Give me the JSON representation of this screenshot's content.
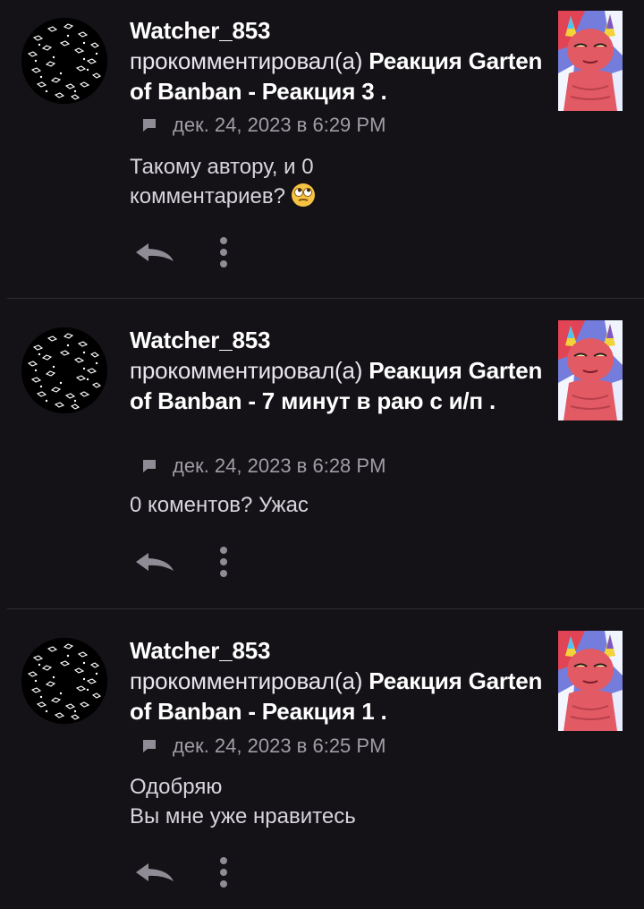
{
  "colors": {
    "background": "#141216",
    "divider": "#2e2c31",
    "primary_text": "#ffffff",
    "secondary_text": "#a09da5",
    "comment_text": "#d7d4dc",
    "icon": "#8f8c95"
  },
  "icons": {
    "comment": "speech-bubble-icon",
    "reply": "reply-arrow-icon",
    "more": "vertical-dots-icon"
  },
  "notifications": [
    {
      "username": "Watcher_853",
      "action": "прокомментировал(а) ",
      "post_title": "Реакция Garten of Banban - Реакция 3",
      "title_end": " .",
      "timestamp": "дек. 24, 2023 в 6:29 PM",
      "comment": "Такому автору, и 0\nкомментариев?",
      "emoji": "face-with-rolling-eyes"
    },
    {
      "username": "Watcher_853",
      "action": "прокомментировал(а) ",
      "post_title": "Реакция Garten of Banban - 7 минут в раю с и/п",
      "title_end": " .",
      "timestamp": "дек. 24, 2023 в 6:28 PM",
      "comment": "0 коментов? Ужас"
    },
    {
      "username": "Watcher_853",
      "action": "прокомментировал(а) ",
      "post_title": "Реакция Garten of Banban - Реакция 1",
      "title_end": " .",
      "timestamp": "дек. 24, 2023 в 6:25 PM",
      "comment": "Одобряю\nВы мне уже нравитесь"
    }
  ]
}
